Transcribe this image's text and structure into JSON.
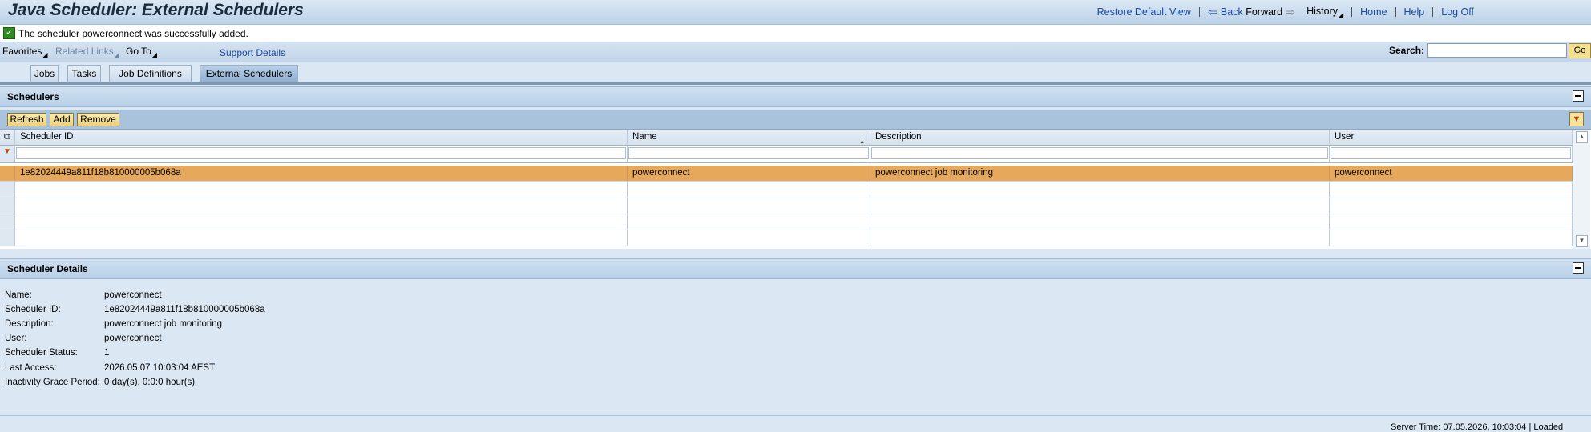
{
  "header": {
    "title": "Java Scheduler: External Schedulers",
    "restore_default_view": "Restore Default View",
    "back": "Back",
    "forward": "Forward",
    "history": "History",
    "home": "Home",
    "help": "Help",
    "log_off": "Log Off"
  },
  "message": {
    "type": "success",
    "text": "The scheduler powerconnect was successfully added."
  },
  "menu": {
    "favorites": "Favorites",
    "related_links": "Related Links",
    "go_to": "Go To",
    "support_details": "Support Details",
    "search_label": "Search:",
    "search_value": "",
    "go_button": "Go"
  },
  "tabs": [
    {
      "label": "Jobs",
      "active": false
    },
    {
      "label": "Tasks",
      "active": false
    },
    {
      "label": "Job Definitions",
      "active": false
    },
    {
      "label": "External Schedulers",
      "active": true
    }
  ],
  "schedulers_panel": {
    "title": "Schedulers",
    "buttons": {
      "refresh": "Refresh",
      "add": "Add",
      "remove": "Remove"
    },
    "columns": [
      "Scheduler ID",
      "Name",
      "Description",
      "User"
    ],
    "sorted_column": "Name",
    "rows": [
      {
        "scheduler_id": "1e82024449a811f18b810000005b068a",
        "name": "powerconnect",
        "description": "powerconnect job monitoring",
        "user": "powerconnect",
        "selected": true
      }
    ],
    "empty_rows": 4
  },
  "details_panel": {
    "title": "Scheduler Details",
    "fields": [
      {
        "label": "Name:",
        "value": "powerconnect"
      },
      {
        "label": "Scheduler ID:",
        "value": "1e82024449a811f18b810000005b068a"
      },
      {
        "label": "Description:",
        "value": "powerconnect job monitoring"
      },
      {
        "label": "User:",
        "value": "powerconnect"
      },
      {
        "label": "Scheduler Status:",
        "value": "1"
      },
      {
        "label": "Last Access:",
        "value": "2026.05.07 10:03:04 AEST"
      },
      {
        "label": "Inactivity Grace Period:",
        "value": "0 day(s), 0:0:0 hour(s)"
      }
    ]
  },
  "footer": {
    "server_time": "Server Time: 07.05.2026, 10:03:04 | Loaded"
  },
  "colors": {
    "selected_row": "#e6a85a",
    "page_background": "#dbe7f3",
    "link": "#1a4aa0",
    "button": "#ecd27a"
  }
}
